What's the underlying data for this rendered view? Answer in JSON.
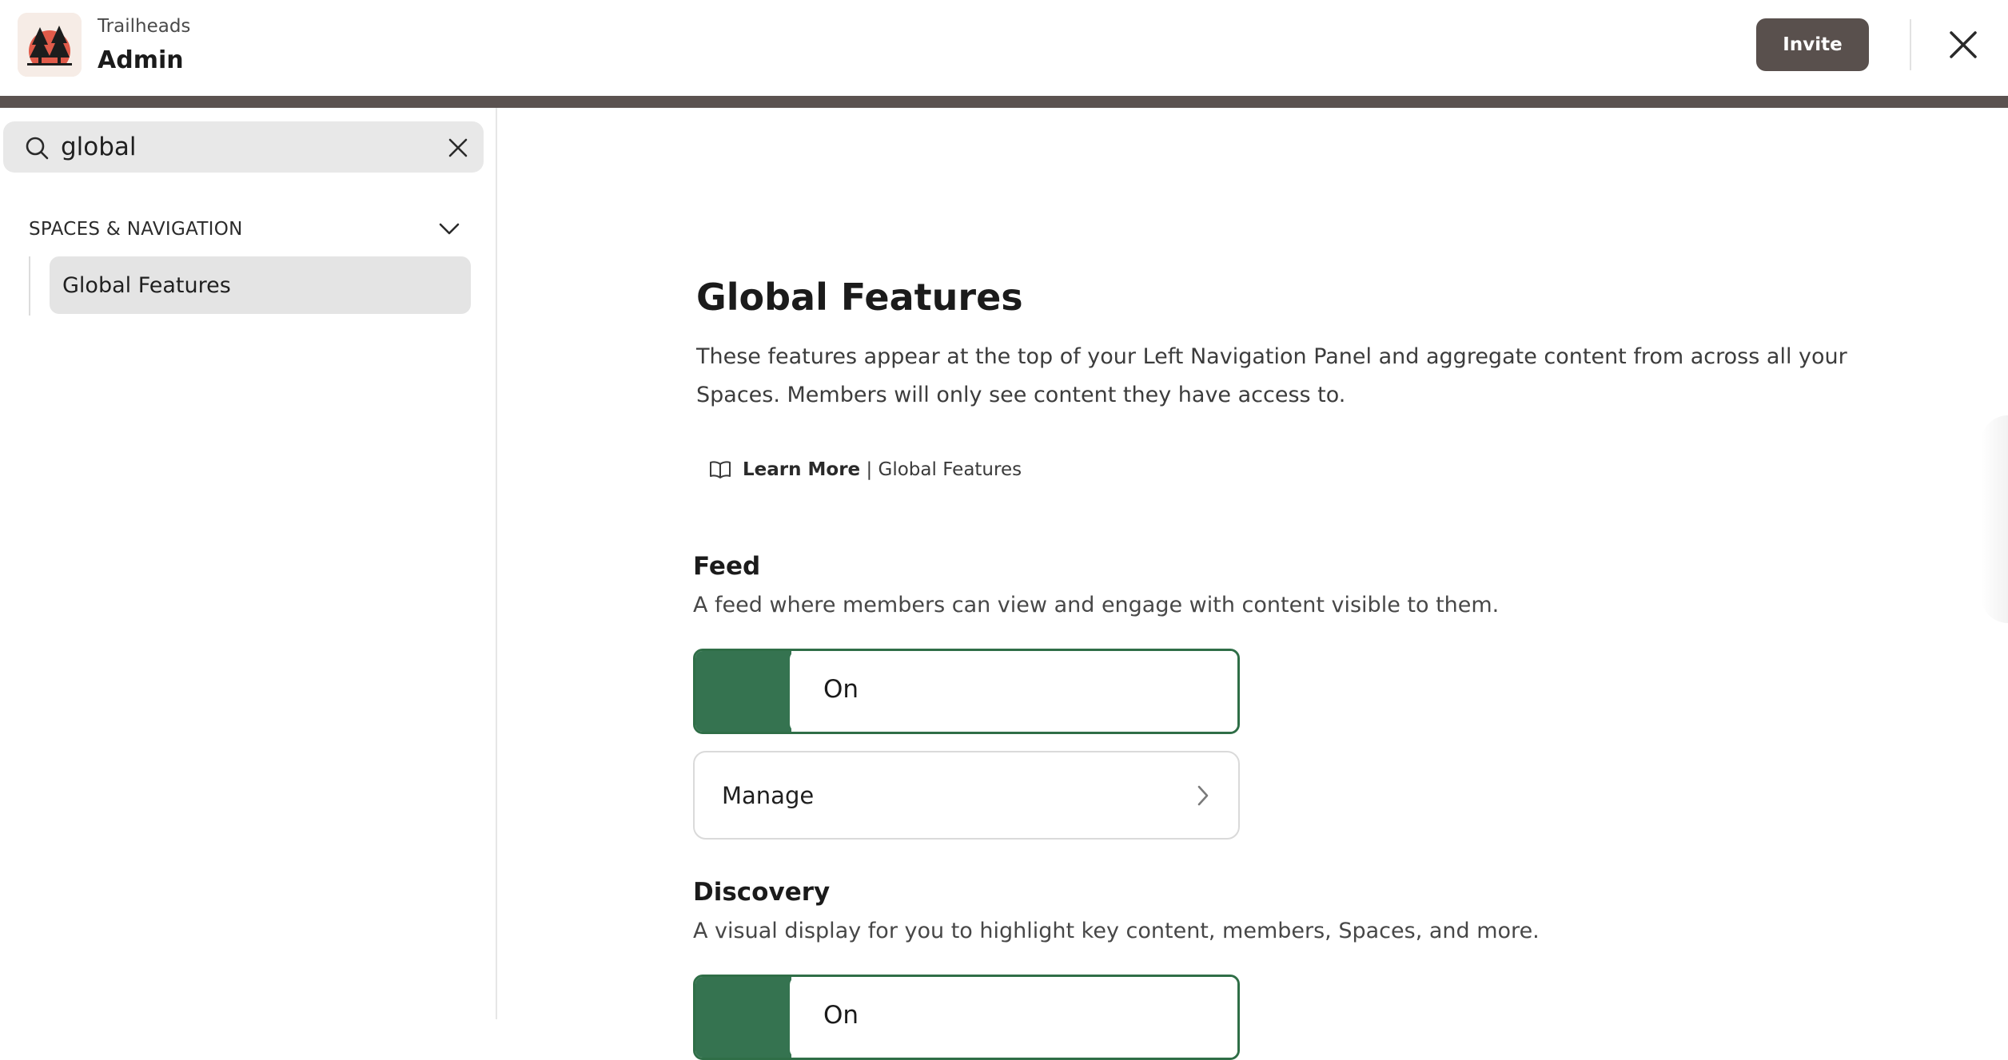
{
  "header": {
    "org_name": "Trailheads",
    "title": "Admin",
    "invite_label": "Invite",
    "logo_icon": "pine-trees-sunset-logo",
    "close_icon": "close-icon"
  },
  "colors": {
    "accent_bar": "#5b5250",
    "invite_bg": "#59504d",
    "toggle_on": "#357350",
    "toggle_border": "#2f6e47",
    "logo_sun": "#e15b4a"
  },
  "sidebar": {
    "search": {
      "value": "global",
      "placeholder": "Search"
    },
    "sections": [
      {
        "title": "SPACES & NAVIGATION",
        "expanded": true,
        "items": [
          {
            "label": "Global Features",
            "selected": true
          }
        ]
      }
    ]
  },
  "main": {
    "title": "Global Features",
    "description": "These features appear at the top of your Left Navigation Panel and aggregate content from across all your Spaces. Members will only see content they have access to.",
    "learn_more": {
      "bold": "Learn More",
      "rest": " | Global Features",
      "icon": "book-icon"
    },
    "features": [
      {
        "title": "Feed",
        "description": "A feed where members can view and engage with content visible to them.",
        "toggle_label": "On",
        "enabled": true,
        "manage_label": "Manage"
      },
      {
        "title": "Discovery",
        "description": "A visual display for you to highlight key content, members, Spaces, and more.",
        "toggle_label": "On",
        "enabled": true
      }
    ]
  }
}
